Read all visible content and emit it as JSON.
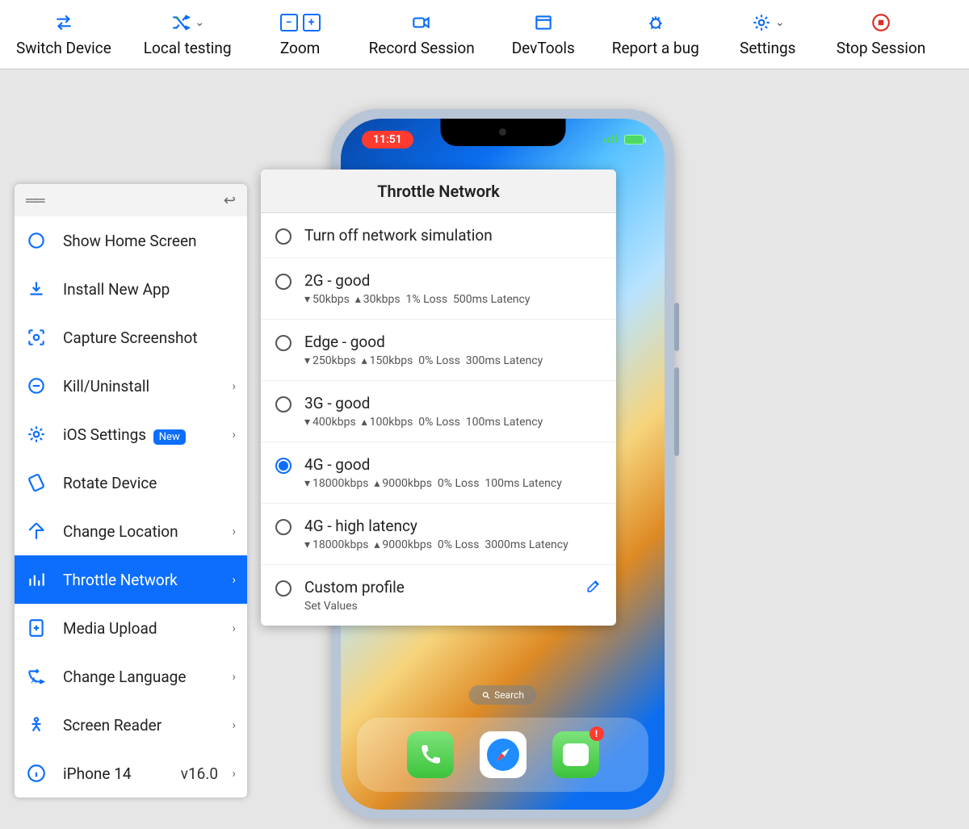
{
  "toolbar": {
    "switch_device": "Switch Device",
    "local_testing": "Local testing",
    "zoom": "Zoom",
    "record_session": "Record Session",
    "devtools": "DevTools",
    "report_bug": "Report a bug",
    "settings": "Settings",
    "stop_session": "Stop Session"
  },
  "sidebar": {
    "items": [
      {
        "label": "Show Home Screen",
        "chevron": false
      },
      {
        "label": "Install New App",
        "chevron": false
      },
      {
        "label": "Capture Screenshot",
        "chevron": false
      },
      {
        "label": "Kill/Uninstall",
        "chevron": true
      },
      {
        "label": "iOS Settings",
        "chevron": true,
        "badge": "New"
      },
      {
        "label": "Rotate Device",
        "chevron": false
      },
      {
        "label": "Change Location",
        "chevron": true
      },
      {
        "label": "Throttle Network",
        "chevron": true,
        "active": true
      },
      {
        "label": "Media Upload",
        "chevron": true
      },
      {
        "label": "Change Language",
        "chevron": true
      },
      {
        "label": "Screen Reader",
        "chevron": true
      }
    ],
    "device": {
      "name": "iPhone 14",
      "version": "v16.0"
    }
  },
  "throttle": {
    "title": "Throttle Network",
    "options": [
      {
        "title": "Turn off network simulation"
      },
      {
        "title": "2G - good",
        "down": "50kbps",
        "up": "30kbps",
        "loss": "1% Loss",
        "lat": "500ms Latency"
      },
      {
        "title": "Edge - good",
        "down": "250kbps",
        "up": "150kbps",
        "loss": "0% Loss",
        "lat": "300ms Latency"
      },
      {
        "title": "3G - good",
        "down": "400kbps",
        "up": "100kbps",
        "loss": "0% Loss",
        "lat": "100ms Latency"
      },
      {
        "title": "4G - good",
        "down": "18000kbps",
        "up": "9000kbps",
        "loss": "0% Loss",
        "lat": "100ms Latency",
        "selected": true
      },
      {
        "title": "4G - high latency",
        "down": "18000kbps",
        "up": "9000kbps",
        "loss": "0% Loss",
        "lat": "3000ms Latency"
      },
      {
        "title": "Custom profile",
        "sub": "Set Values",
        "edit": true
      }
    ]
  },
  "phone": {
    "time": "11:51",
    "search": "Search",
    "dock_badge": "!"
  }
}
